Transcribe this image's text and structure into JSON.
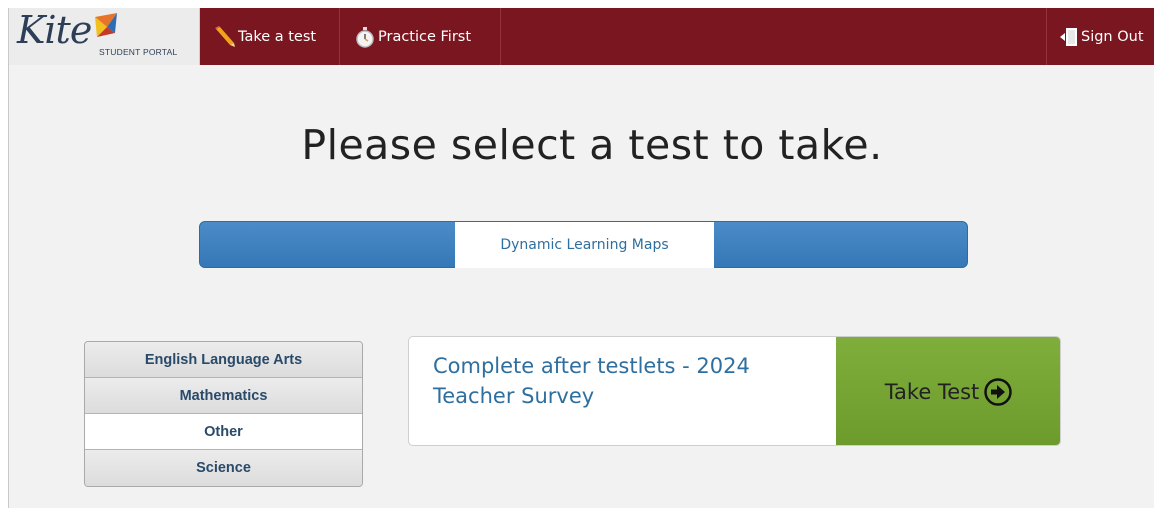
{
  "brand": {
    "name": "Kite",
    "subtitle": "STUDENT PORTAL",
    "colors": {
      "nav": "#7a1620",
      "accent_blue": "#3a7dbc",
      "link": "#2f6f9f",
      "go_green": "#76a534"
    }
  },
  "nav": {
    "take_test": {
      "label": "Take a test",
      "icon": "pencil-icon"
    },
    "practice_first": {
      "label": "Practice First",
      "icon": "stopwatch-icon"
    },
    "sign_out": {
      "label": "Sign Out",
      "icon": "door-exit-icon"
    }
  },
  "main": {
    "headline": "Please select a test to take.",
    "program_tab": "Dynamic Learning Maps",
    "subjects": [
      {
        "label": "English Language Arts",
        "active": false
      },
      {
        "label": "Mathematics",
        "active": false
      },
      {
        "label": "Other",
        "active": true
      },
      {
        "label": "Science",
        "active": false
      }
    ],
    "test": {
      "name": "Complete after testlets - 2024 Teacher Survey",
      "action_label": "Take Test",
      "action_icon": "circle-arrow-right-icon"
    }
  }
}
